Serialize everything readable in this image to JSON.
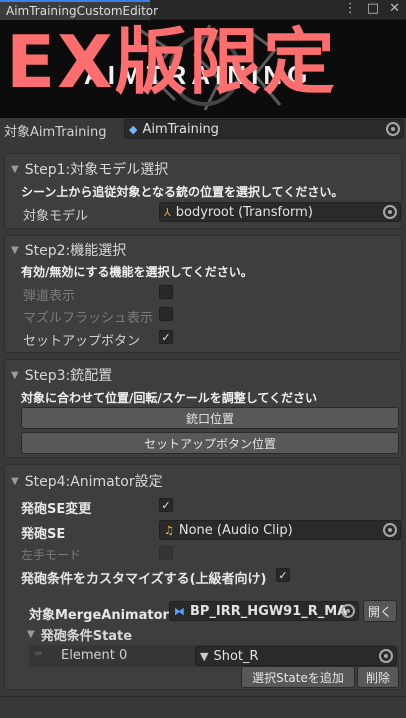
{
  "window": {
    "tab_title": "AimTrainingCustomEditor",
    "menu_icon": "⋮",
    "maximize_icon": "□",
    "close_icon": "✕"
  },
  "banner": {
    "logo_text": "AIMTRAINING",
    "overlay_text": "EX版限定"
  },
  "target": {
    "label": "対象AimTraining",
    "value": "AimTraining"
  },
  "step1": {
    "header": "Step1:対象モデル選択",
    "description": "シーン上から追従対象となる銃の位置を選択してください。",
    "model_label": "対象モデル",
    "model_value": "bodyroot (Transform)"
  },
  "step2": {
    "header": "Step2:機能選択",
    "description": "有効/無効にする機能を選択してください。",
    "options": [
      {
        "label": "弾道表示",
        "checked": false,
        "dim": true
      },
      {
        "label": "マズルフラッシュ表示",
        "checked": false,
        "dim": true
      },
      {
        "label": "セットアップボタン",
        "checked": true,
        "dim": false
      }
    ]
  },
  "step3": {
    "header": "Step3:銃配置",
    "description": "対象に合わせて位置/回転/スケールを調整してください",
    "button_muzzle": "銃口位置",
    "button_setup": "セットアップボタン位置"
  },
  "step4": {
    "header": "Step4:Animator設定",
    "se_change_label": "発砲SE変更",
    "se_label": "発砲SE",
    "se_value": "None (Audio Clip)",
    "left_hand_label": "左手モード",
    "customize_label": "発砲条件をカスタマイズする(上級者向け)",
    "merge_label": "対象MergeAnimator",
    "merge_value": "BP_IRR_HGW91_R_MA",
    "open_button": "開く",
    "state_header": "発砲条件State",
    "element_label": "Element 0",
    "element_value": "Shot_R",
    "add_state_button": "選択Stateを追加",
    "delete_button": "削除"
  },
  "colors": {
    "accent": "#3a7ff0",
    "overlay": "#ff6e6e",
    "background": "#383838"
  }
}
